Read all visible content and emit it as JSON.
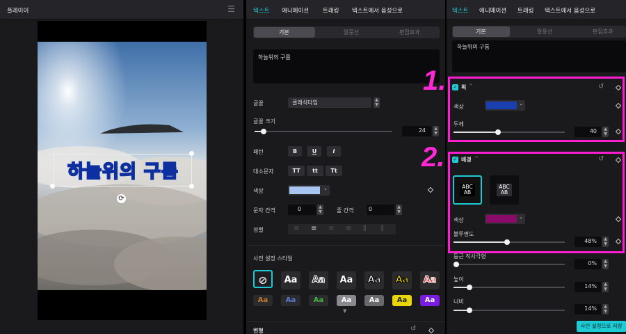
{
  "player": {
    "title": "플레이어",
    "caption": "하늘위의 구름"
  },
  "mid": {
    "tabs": [
      "텍스트",
      "애니메이션",
      "트래킹",
      "텍스트에서 음성으로"
    ],
    "subtabs": [
      "기본",
      "말풍선",
      "편집효과"
    ],
    "text_value": "하늘위의 구름",
    "font_label": "글꼴",
    "font_value": "클래식타입",
    "size_label": "글꼴 크기",
    "size_value": "24",
    "pattern_label": "패턴",
    "pattern_btns": [
      "B",
      "U",
      "I"
    ],
    "case_label": "대소문자",
    "case_btns": [
      "TT",
      "tt",
      "Tt"
    ],
    "color_label": "색상",
    "color_value": "#a8c4f0",
    "spacing_label": "문자 간격",
    "spacing_value": "0",
    "line_label": "줄 간격",
    "line_value": "0",
    "align_label": "정렬",
    "preset_title": "사전 설정 스타일",
    "transform_label": "변형"
  },
  "right": {
    "tabs": [
      "텍스트",
      "애니메이션",
      "트래킹",
      "텍스트에서 음성으로"
    ],
    "subtabs": [
      "기본",
      "말풍선",
      "편집효과"
    ],
    "text_value": "하늘위의 구름",
    "stroke_title": "획",
    "stroke_color_label": "색상",
    "stroke_color": "#1a3fb0",
    "thickness_label": "두께",
    "thickness_value": "40",
    "bg_title": "배경",
    "bg_opt": "ABC\nAB",
    "bg_color_label": "색상",
    "bg_color": "#8a0a6a",
    "opacity_label": "불투명도",
    "opacity_value": "48%",
    "radius_label": "둥근 직사각형",
    "radius_value": "0%",
    "height_label": "높이",
    "height_value": "14%",
    "width_label": "너비",
    "width_value": "14%",
    "save_preset": "사전 설정으로 저장"
  },
  "annotations": {
    "n1": "1.",
    "n2": "2."
  }
}
